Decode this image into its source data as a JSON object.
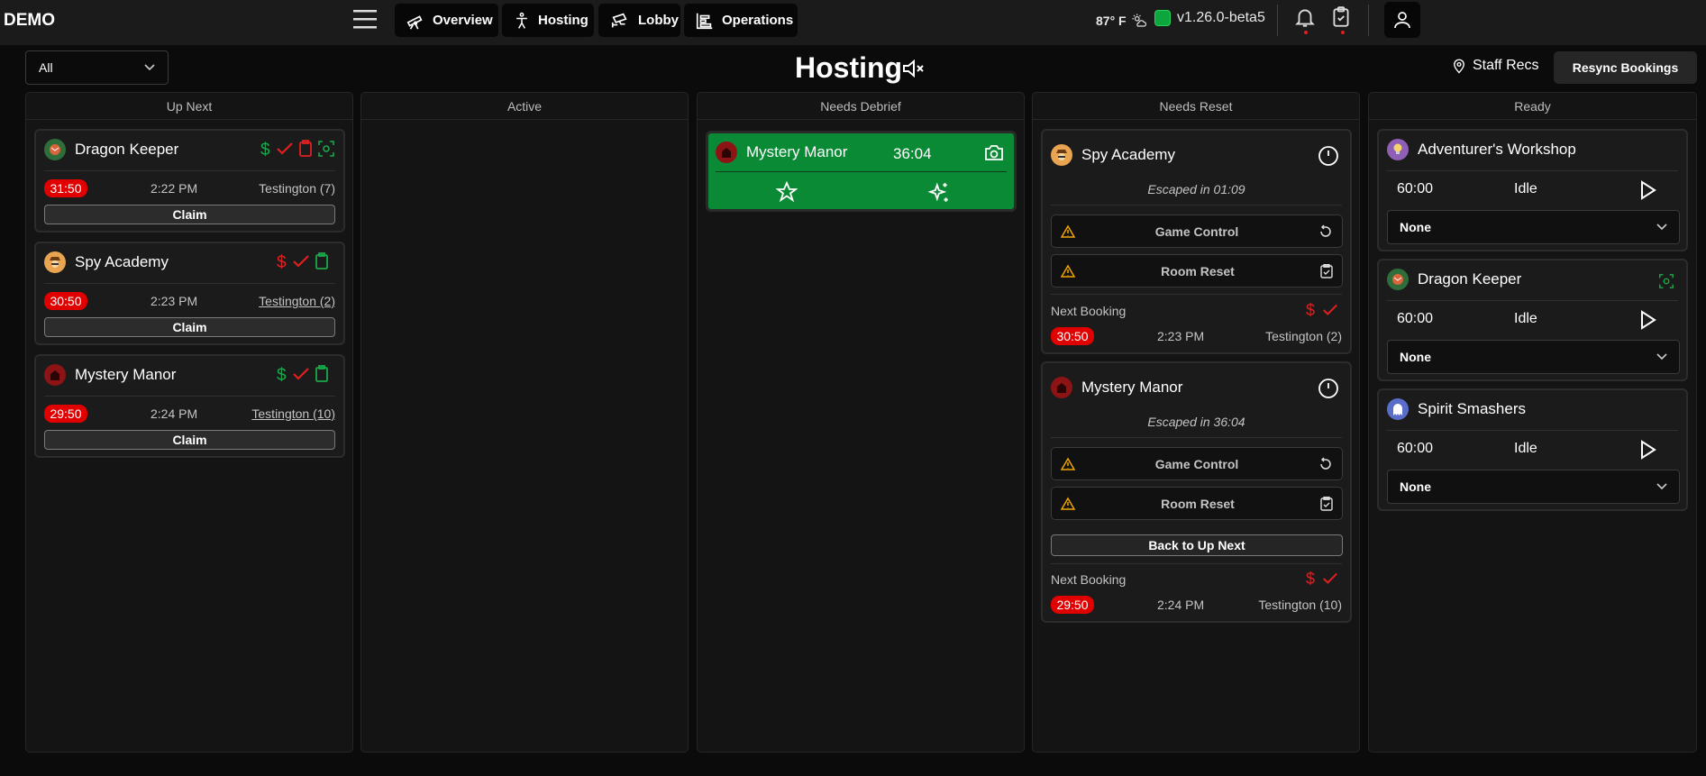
{
  "brand": "DEMO",
  "nav": [
    {
      "label": "Overview",
      "icon": "telescope-icon"
    },
    {
      "label": "Hosting",
      "icon": "person-icon"
    },
    {
      "label": "Lobby",
      "icon": "cctv-icon"
    },
    {
      "label": "Operations",
      "icon": "chart-icon"
    }
  ],
  "weather": "87° F",
  "version": "v1.26.0-beta5",
  "filter": {
    "value": "All"
  },
  "page_title": "Hosting",
  "staff_recs": "Staff Recs",
  "resync": "Resync Bookings",
  "columns": [
    "Up Next",
    "Active",
    "Needs Debrief",
    "Needs Reset",
    "Ready"
  ],
  "up_next": [
    {
      "name": "Dragon Keeper",
      "timer": "31:50",
      "time": "2:22 PM",
      "booking": "Testington (7)",
      "claim": "Claim",
      "status_colors": [
        "#1aa84a",
        "#e02020",
        "#e02020",
        "#1aa84a"
      ]
    },
    {
      "name": "Spy Academy",
      "timer": "30:50",
      "time": "2:23 PM",
      "booking": "Testington (2)",
      "claim": "Claim",
      "status_colors": [
        "#e02020",
        "#e02020",
        "#1aa84a"
      ]
    },
    {
      "name": "Mystery Manor",
      "timer": "29:50",
      "time": "2:24 PM",
      "booking": "Testington (10)",
      "claim": "Claim",
      "status_colors": [
        "#1aa84a",
        "#e02020",
        "#1aa84a"
      ]
    }
  ],
  "debrief": {
    "name": "Mystery Manor",
    "time": "36:04",
    "color": "#0a8a35"
  },
  "needs_reset": [
    {
      "name": "Spy Academy",
      "escaped": "Escaped in 01:09",
      "game_control": "Game Control",
      "room_reset": "Room Reset",
      "next_booking_label": "Next Booking",
      "timer": "30:50",
      "time": "2:23 PM",
      "booking": "Testington (2)"
    },
    {
      "name": "Mystery Manor",
      "escaped": "Escaped in 36:04",
      "game_control": "Game Control",
      "room_reset": "Room Reset",
      "back_btn": "Back to Up Next",
      "next_booking_label": "Next Booking",
      "timer": "29:50",
      "time": "2:24 PM",
      "booking": "Testington (10)"
    }
  ],
  "ready": [
    {
      "name": "Adventurer's Workshop",
      "time": "60:00",
      "state": "Idle",
      "select": "None"
    },
    {
      "name": "Dragon Keeper",
      "time": "60:00",
      "state": "Idle",
      "select": "None"
    },
    {
      "name": "Spirit Smashers",
      "time": "60:00",
      "state": "Idle",
      "select": "None"
    }
  ],
  "colors": {
    "accent_red": "#e00000",
    "accent_green": "#0a8a35",
    "warning": "#f0a500"
  }
}
